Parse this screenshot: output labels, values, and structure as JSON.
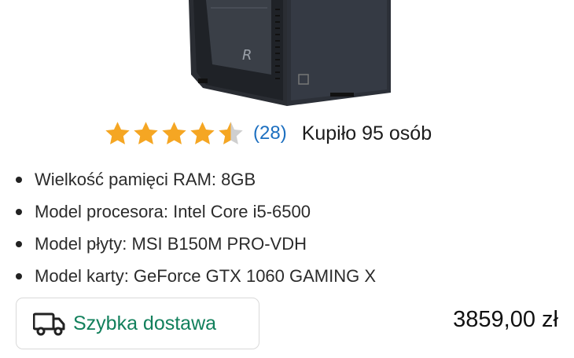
{
  "product": {
    "rating": {
      "value": 4.5,
      "max": 5,
      "count_text": "(28)"
    },
    "bought_text": "Kupiło 95 osób",
    "specs": [
      "Wielkość pamięci RAM: 8GB",
      "Model procesora: Intel Core i5-6500",
      "Model płyty: MSI B150M PRO-VDH",
      "Model karty: GeForce GTX 1060 GAMING X"
    ],
    "delivery_label": "Szybka dostawa",
    "price": "3859,00 zł"
  },
  "colors": {
    "star": "#f5a623",
    "star_empty": "#cfcfcf",
    "link": "#1c6fc0",
    "delivery": "#12805c"
  },
  "icons": {
    "delivery": "truck-icon",
    "rating": "star-icon"
  }
}
